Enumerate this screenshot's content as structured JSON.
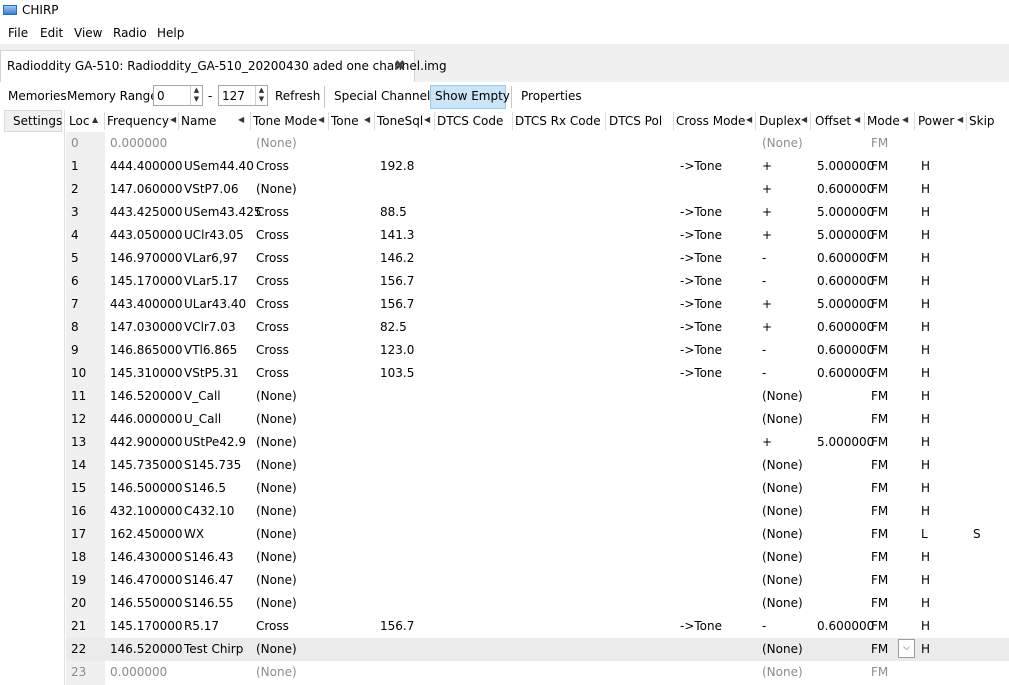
{
  "app": {
    "title": "CHIRP"
  },
  "menu": [
    "File",
    "Edit",
    "View",
    "Radio",
    "Help"
  ],
  "file_tab": {
    "label": "Radioddity GA-510: Radioddity_GA-510_20200430 aded one channel.img"
  },
  "toolbar": {
    "memories_label": "Memories",
    "memory_range_label": "Memory Range:",
    "range_start": "0",
    "range_dash": "-",
    "range_end": "127",
    "refresh_label": "Refresh",
    "special_channels_label": "Special Channels",
    "show_empty_label": "Show Empty",
    "properties_label": "Properties"
  },
  "side": {
    "settings_label": "Settings"
  },
  "columns": [
    "Loc",
    "Frequency",
    "Name",
    "Tone Mode",
    "Tone",
    "ToneSql",
    "DTCS Code",
    "DTCS Rx Code",
    "DTCS Pol",
    "Cross Mode",
    "Duplex",
    "Offset",
    "Mode",
    "Power",
    "Skip"
  ],
  "rows": [
    {
      "loc": "0",
      "freq": "0.000000",
      "name": "",
      "tmode": "(None)",
      "tone": "",
      "tsql": "",
      "cross": "",
      "duplex": "(None)",
      "offset": "",
      "mode": "FM",
      "power": "",
      "skip": "",
      "empty": true
    },
    {
      "loc": "1",
      "freq": "444.400000",
      "name": "USem44.40",
      "tmode": "Cross",
      "tone": "",
      "tsql": "192.8",
      "cross": "->Tone",
      "duplex": "+",
      "offset": "5.000000",
      "mode": "FM",
      "power": "H",
      "skip": ""
    },
    {
      "loc": "2",
      "freq": "147.060000",
      "name": "VStP7.06",
      "tmode": "(None)",
      "tone": "",
      "tsql": "",
      "cross": "",
      "duplex": "+",
      "offset": "0.600000",
      "mode": "FM",
      "power": "H",
      "skip": ""
    },
    {
      "loc": "3",
      "freq": "443.425000",
      "name": "USem43.425",
      "tmode": "Cross",
      "tone": "",
      "tsql": "88.5",
      "cross": "->Tone",
      "duplex": "+",
      "offset": "5.000000",
      "mode": "FM",
      "power": "H",
      "skip": ""
    },
    {
      "loc": "4",
      "freq": "443.050000",
      "name": "UClr43.05",
      "tmode": "Cross",
      "tone": "",
      "tsql": "141.3",
      "cross": "->Tone",
      "duplex": "+",
      "offset": "5.000000",
      "mode": "FM",
      "power": "H",
      "skip": ""
    },
    {
      "loc": "5",
      "freq": "146.970000",
      "name": "VLar6,97",
      "tmode": "Cross",
      "tone": "",
      "tsql": "146.2",
      "cross": "->Tone",
      "duplex": "-",
      "offset": "0.600000",
      "mode": "FM",
      "power": "H",
      "skip": ""
    },
    {
      "loc": "6",
      "freq": "145.170000",
      "name": "VLar5.17",
      "tmode": "Cross",
      "tone": "",
      "tsql": "156.7",
      "cross": "->Tone",
      "duplex": "-",
      "offset": "0.600000",
      "mode": "FM",
      "power": "H",
      "skip": ""
    },
    {
      "loc": "7",
      "freq": "443.400000",
      "name": "ULar43.40",
      "tmode": "Cross",
      "tone": "",
      "tsql": "156.7",
      "cross": "->Tone",
      "duplex": "+",
      "offset": "5.000000",
      "mode": "FM",
      "power": "H",
      "skip": ""
    },
    {
      "loc": "8",
      "freq": "147.030000",
      "name": "VClr7.03",
      "tmode": "Cross",
      "tone": "",
      "tsql": "82.5",
      "cross": "->Tone",
      "duplex": "+",
      "offset": "0.600000",
      "mode": "FM",
      "power": "H",
      "skip": ""
    },
    {
      "loc": "9",
      "freq": "146.865000",
      "name": "VTl6.865",
      "tmode": "Cross",
      "tone": "",
      "tsql": "123.0",
      "cross": "->Tone",
      "duplex": "-",
      "offset": "0.600000",
      "mode": "FM",
      "power": "H",
      "skip": ""
    },
    {
      "loc": "10",
      "freq": "145.310000",
      "name": "VStP5.31",
      "tmode": "Cross",
      "tone": "",
      "tsql": "103.5",
      "cross": "->Tone",
      "duplex": "-",
      "offset": "0.600000",
      "mode": "FM",
      "power": "H",
      "skip": ""
    },
    {
      "loc": "11",
      "freq": "146.520000",
      "name": "V_Call",
      "tmode": "(None)",
      "tone": "",
      "tsql": "",
      "cross": "",
      "duplex": "(None)",
      "offset": "",
      "mode": "FM",
      "power": "H",
      "skip": ""
    },
    {
      "loc": "12",
      "freq": "446.000000",
      "name": "U_Call",
      "tmode": "(None)",
      "tone": "",
      "tsql": "",
      "cross": "",
      "duplex": "(None)",
      "offset": "",
      "mode": "FM",
      "power": "H",
      "skip": ""
    },
    {
      "loc": "13",
      "freq": "442.900000",
      "name": "UStPe42.9",
      "tmode": "(None)",
      "tone": "",
      "tsql": "",
      "cross": "",
      "duplex": "+",
      "offset": "5.000000",
      "mode": "FM",
      "power": "H",
      "skip": ""
    },
    {
      "loc": "14",
      "freq": "145.735000",
      "name": "S145.735",
      "tmode": "(None)",
      "tone": "",
      "tsql": "",
      "cross": "",
      "duplex": "(None)",
      "offset": "",
      "mode": "FM",
      "power": "H",
      "skip": ""
    },
    {
      "loc": "15",
      "freq": "146.500000",
      "name": "S146.5",
      "tmode": "(None)",
      "tone": "",
      "tsql": "",
      "cross": "",
      "duplex": "(None)",
      "offset": "",
      "mode": "FM",
      "power": "H",
      "skip": ""
    },
    {
      "loc": "16",
      "freq": "432.100000",
      "name": "C432.10",
      "tmode": "(None)",
      "tone": "",
      "tsql": "",
      "cross": "",
      "duplex": "(None)",
      "offset": "",
      "mode": "FM",
      "power": "H",
      "skip": ""
    },
    {
      "loc": "17",
      "freq": "162.450000",
      "name": "WX",
      "tmode": "(None)",
      "tone": "",
      "tsql": "",
      "cross": "",
      "duplex": "(None)",
      "offset": "",
      "mode": "FM",
      "power": "L",
      "skip": "S"
    },
    {
      "loc": "18",
      "freq": "146.430000",
      "name": "S146.43",
      "tmode": "(None)",
      "tone": "",
      "tsql": "",
      "cross": "",
      "duplex": "(None)",
      "offset": "",
      "mode": "FM",
      "power": "H",
      "skip": ""
    },
    {
      "loc": "19",
      "freq": "146.470000",
      "name": "S146.47",
      "tmode": "(None)",
      "tone": "",
      "tsql": "",
      "cross": "",
      "duplex": "(None)",
      "offset": "",
      "mode": "FM",
      "power": "H",
      "skip": ""
    },
    {
      "loc": "20",
      "freq": "146.550000",
      "name": "S146.55",
      "tmode": "(None)",
      "tone": "",
      "tsql": "",
      "cross": "",
      "duplex": "(None)",
      "offset": "",
      "mode": "FM",
      "power": "H",
      "skip": ""
    },
    {
      "loc": "21",
      "freq": "145.170000",
      "name": "R5.17",
      "tmode": "Cross",
      "tone": "",
      "tsql": "156.7",
      "cross": "->Tone",
      "duplex": "-",
      "offset": "0.600000",
      "mode": "FM",
      "power": "H",
      "skip": ""
    },
    {
      "loc": "22",
      "freq": "146.520000",
      "name": "Test Chirp",
      "tmode": "(None)",
      "tone": "",
      "tsql": "",
      "cross": "",
      "duplex": "(None)",
      "offset": "",
      "mode": "FM",
      "power": "H",
      "skip": "",
      "selected": true
    },
    {
      "loc": "23",
      "freq": "0.000000",
      "name": "",
      "tmode": "(None)",
      "tone": "",
      "tsql": "",
      "cross": "",
      "duplex": "(None)",
      "offset": "",
      "mode": "FM",
      "power": "",
      "skip": "",
      "empty": true
    }
  ]
}
